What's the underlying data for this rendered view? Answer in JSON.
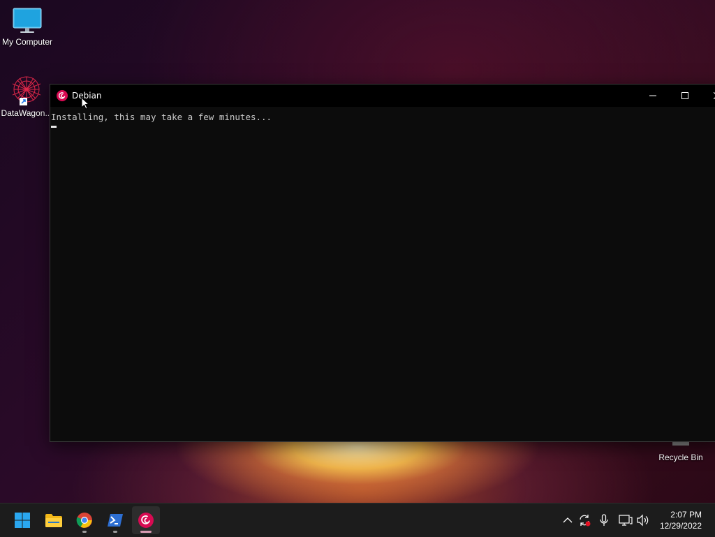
{
  "desktop": {
    "icons": [
      {
        "label": "My Computer"
      },
      {
        "label": "DataWagon..."
      }
    ],
    "recycle_bin": {
      "label": "Recycle Bin"
    }
  },
  "window": {
    "title": "Debian",
    "console_text": "Installing, this may take a few minutes...",
    "controls": {
      "minimize": "minimize-icon",
      "maximize": "maximize-icon",
      "close": "close-icon"
    }
  },
  "taskbar": {
    "apps": [
      {
        "name": "start",
        "icon": "windows-logo-icon"
      },
      {
        "name": "file-explorer",
        "icon": "folder-icon"
      },
      {
        "name": "chrome",
        "icon": "chrome-icon"
      },
      {
        "name": "powershell",
        "icon": "powershell-icon"
      },
      {
        "name": "debian",
        "icon": "debian-icon",
        "active": true
      }
    ],
    "tray": [
      "chevron-up-icon",
      "sync-icon",
      "microphone-icon",
      "network-icon",
      "volume-icon"
    ],
    "clock": {
      "time": "2:07 PM",
      "date": "12/29/2022"
    }
  },
  "colors": {
    "accent": "#d80a52",
    "console_bg": "#0c0c0c",
    "taskbar_bg": "#1c1c1c"
  }
}
